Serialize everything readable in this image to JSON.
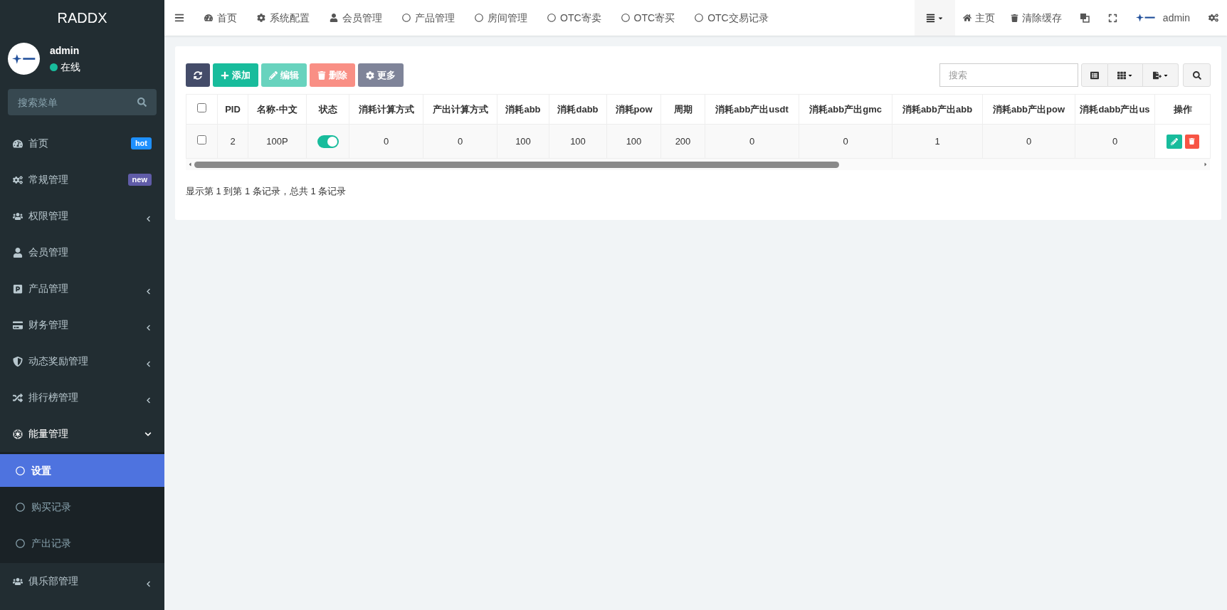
{
  "sidebar": {
    "logo": "RADDX",
    "user": {
      "name": "admin",
      "status": "在线"
    },
    "search": {
      "placeholder": "搜索菜单"
    },
    "items": [
      {
        "label": "首页",
        "badge": {
          "text": "hot",
          "color": "#1e90ff"
        },
        "has_children": false,
        "expanded": false
      },
      {
        "label": "常规管理",
        "badge": {
          "text": "new",
          "color": "#605ca8"
        },
        "has_children": false,
        "expanded": false
      },
      {
        "label": "权限管理",
        "has_children": true,
        "expanded": false
      },
      {
        "label": "会员管理",
        "has_children": false,
        "expanded": false
      },
      {
        "label": "产品管理",
        "has_children": true,
        "expanded": false
      },
      {
        "label": "财务管理",
        "has_children": true,
        "expanded": false
      },
      {
        "label": "动态奖励管理",
        "has_children": true,
        "expanded": false
      },
      {
        "label": "排行榜管理",
        "has_children": true,
        "expanded": false
      },
      {
        "label": "能量管理",
        "has_children": true,
        "expanded": true,
        "children": [
          {
            "label": "设置",
            "selected": true
          },
          {
            "label": "购买记录",
            "selected": false
          },
          {
            "label": "产出记录",
            "selected": false
          }
        ]
      },
      {
        "label": "俱乐部管理",
        "has_children": true,
        "expanded": false
      }
    ]
  },
  "top_nav": {
    "tabs": [
      {
        "label": "首页"
      },
      {
        "label": "系统配置"
      },
      {
        "label": "会员管理"
      },
      {
        "label": "产品管理"
      },
      {
        "label": "房间管理"
      },
      {
        "label": "OTC寄卖"
      },
      {
        "label": "OTC寄买"
      },
      {
        "label": "OTC交易记录"
      }
    ],
    "links": [
      {
        "label": "主页"
      },
      {
        "label": "清除缓存"
      }
    ],
    "user": "admin"
  },
  "toolbar": {
    "buttons": [
      {
        "kind": "refresh",
        "disabled": false
      },
      {
        "kind": "add",
        "label": "添加",
        "disabled": false
      },
      {
        "kind": "edit",
        "label": "编辑",
        "disabled": true
      },
      {
        "kind": "delete",
        "label": "删除",
        "disabled": true
      },
      {
        "kind": "more",
        "label": "更多",
        "disabled": false
      }
    ],
    "search": {
      "placeholder": "搜索"
    }
  },
  "table": {
    "columns": [
      "PID",
      "名称-中文",
      "状态",
      "消耗计算方式",
      "产出计算方式",
      "消耗abb",
      "消耗dabb",
      "消耗pow",
      "周期",
      "消耗abb产出usdt",
      "消耗abb产出gmc",
      "消耗abb产出abb",
      "消耗abb产出pow",
      "消耗dabb产出us",
      "操作"
    ],
    "select_all_checked": false,
    "rows": [
      {
        "checked": false,
        "cells": [
          {
            "kind": "text",
            "text": "2"
          },
          {
            "kind": "text",
            "text": "100P"
          },
          {
            "kind": "toggle",
            "on": true
          },
          {
            "kind": "text",
            "text": "0"
          },
          {
            "kind": "text",
            "text": "0"
          },
          {
            "kind": "text",
            "text": "100"
          },
          {
            "kind": "text",
            "text": "100"
          },
          {
            "kind": "text",
            "text": "100"
          },
          {
            "kind": "text",
            "text": "200"
          },
          {
            "kind": "text",
            "text": "0"
          },
          {
            "kind": "text",
            "text": "0"
          },
          {
            "kind": "text",
            "text": "1"
          },
          {
            "kind": "text",
            "text": "0"
          },
          {
            "kind": "text",
            "text": "0"
          },
          {
            "kind": "actions"
          }
        ]
      }
    ]
  },
  "pagination_info": "显示第 1 到第 1 条记录，总共 1 条记录"
}
